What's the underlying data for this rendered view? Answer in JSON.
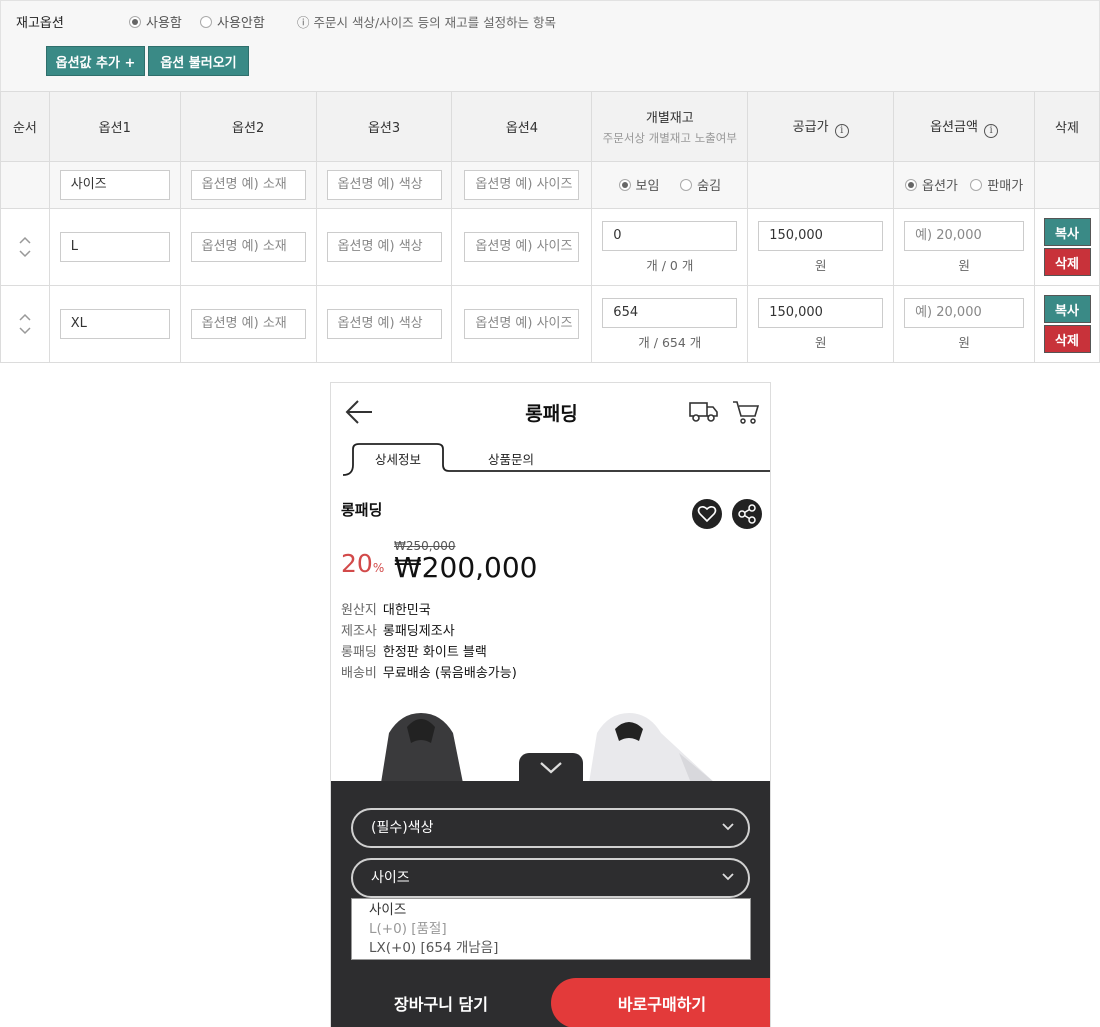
{
  "stock_option": {
    "title": "재고옵션",
    "use_label": "사용함",
    "nouse_label": "사용안함",
    "hint": "ⓘ 주문시 색상/사이즈 등의 재고를 설정하는 항목",
    "add_button": "옵션값 추가 +",
    "load_button": "옵션 불러오기"
  },
  "table": {
    "headers": {
      "order": "순서",
      "opt1": "옵션1",
      "opt2": "옵션2",
      "opt3": "옵션3",
      "opt4": "옵션4",
      "stock": "개별재고",
      "stock_sub": "주문서상 개별재고 노출여부",
      "supply": "공급가",
      "amount": "옵션금액",
      "delete": "삭제"
    },
    "name_row": {
      "opt1": "사이즈",
      "opt2_ph": "옵션명 예) 소재",
      "opt3_ph": "옵션명 예) 색상",
      "opt4_ph": "옵션명 예) 사이즈",
      "show_label": "보임",
      "hide_label": "숨김",
      "opt_price_label": "옵션가",
      "sale_price_label": "판매가"
    },
    "rows": [
      {
        "opt1": "L",
        "opt2_ph": "옵션명 예) 소재",
        "opt3_ph": "옵션명 예) 색상",
        "opt4_ph": "옵션명 예) 사이즈",
        "stock": "0",
        "stock_unit": "개 / 0 개",
        "supply": "150,000",
        "supply_unit": "원",
        "amount_ph": "예) 20,000",
        "amount_unit": "원",
        "copy": "복사",
        "del": "삭제"
      },
      {
        "opt1": "XL",
        "opt2_ph": "옵션명 예) 소재",
        "opt3_ph": "옵션명 예) 색상",
        "opt4_ph": "옵션명 예) 사이즈",
        "stock": "654",
        "stock_unit": "개 / 654 개",
        "supply": "150,000",
        "supply_unit": "원",
        "amount_ph": "예) 20,000",
        "amount_unit": "원",
        "copy": "복사",
        "del": "삭제"
      }
    ]
  },
  "phone": {
    "title": "롱패딩",
    "tabs": [
      "상세정보",
      "상품문의"
    ],
    "product_name": "롱패딩",
    "discount": "20",
    "discount_unit": "%",
    "original_price": "₩250,000",
    "price": "₩200,000",
    "specs": [
      {
        "k": "원산지",
        "v": "대한민국"
      },
      {
        "k": "제조사",
        "v": "롱패딩제조사"
      },
      {
        "k": "롱패딩",
        "v": "한정판 화이트 블랙"
      },
      {
        "k": "배송비",
        "v": "무료배송 (묶음배송가능)"
      }
    ],
    "select_color": "(필수)색상",
    "select_size": "사이즈",
    "dropdown": [
      "사이즈",
      "L(+0) [품절]",
      "LX(+0) [654 개남음]"
    ],
    "cart_button": "장바구니 담기",
    "buy_button": "바로구매하기",
    "colors": {
      "accent": "#3a8a86",
      "danger": "#c8323a",
      "buy": "#e33a3a",
      "sheet": "#2d2d2f"
    }
  }
}
